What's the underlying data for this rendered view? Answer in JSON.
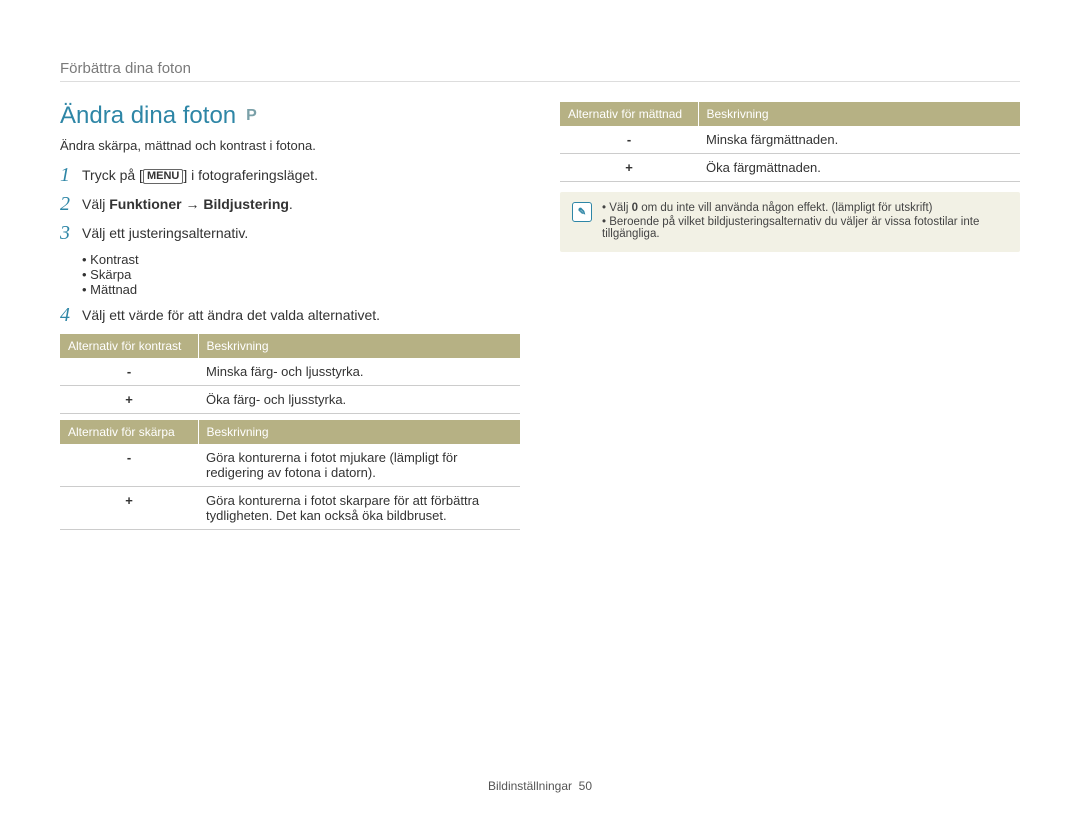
{
  "breadcrumb": "Förbättra dina foton",
  "title": "Ändra dina foton",
  "mode_icon_label": "P",
  "intro": "Ändra skärpa, mättnad och kontrast i fotona.",
  "steps": {
    "s1": {
      "num": "1",
      "pre": "Tryck på [",
      "menu": "MENU",
      "post": "] i fotograferingsläget."
    },
    "s2": {
      "num": "2",
      "pre": "Välj ",
      "b1": "Funktioner",
      "arrow": " → ",
      "b2": "Bildjustering",
      "post": "."
    },
    "s3": {
      "num": "3",
      "text": "Välj ett justeringsalternativ.",
      "items": [
        "Kontrast",
        "Skärpa",
        "Mättnad"
      ]
    },
    "s4": {
      "num": "4",
      "text": "Välj ett värde för att ändra det valda alternativet."
    }
  },
  "tables": {
    "contrast": {
      "h1": "Alternativ för kontrast",
      "h2": "Beskrivning",
      "r1k": "-",
      "r1v": "Minska färg- och ljusstyrka.",
      "r2k": "+",
      "r2v": "Öka färg- och ljusstyrka."
    },
    "sharpness": {
      "h1": "Alternativ för skärpa",
      "h2": "Beskrivning",
      "r1k": "-",
      "r1v": "Göra konturerna i fotot mjukare (lämpligt för redigering av fotona i datorn).",
      "r2k": "+",
      "r2v": "Göra konturerna i fotot skarpare för att förbättra tydligheten. Det kan också öka bildbruset."
    },
    "saturation": {
      "h1": "Alternativ för mättnad",
      "h2": "Beskrivning",
      "r1k": "-",
      "r1v": "Minska färgmättnaden.",
      "r2k": "+",
      "r2v": "Öka färgmättnaden."
    }
  },
  "note": {
    "n1_pre": "Välj ",
    "n1_b": "0",
    "n1_post": " om du inte vill använda någon effekt. (lämpligt för utskrift)",
    "n2": "Beroende på vilket bildjusteringsalternativ du väljer är vissa fotostilar inte tillgängliga."
  },
  "footer": {
    "section": "Bildinställningar",
    "page": "50"
  }
}
